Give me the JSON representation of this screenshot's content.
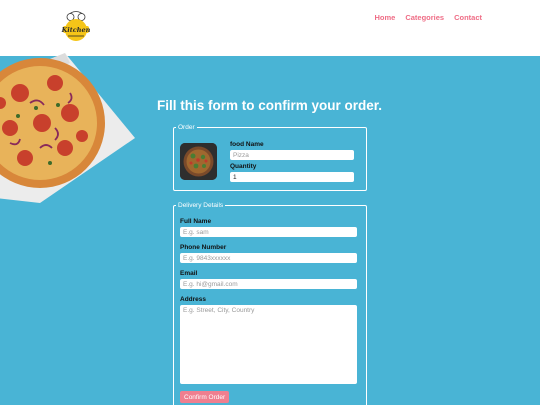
{
  "nav": {
    "home": "Home",
    "categories": "Categories",
    "contact": "Contact"
  },
  "logo": {
    "text": "Kitchen"
  },
  "form": {
    "title": "Fill this form to confirm your order.",
    "order": {
      "legend": "Order",
      "food_name_label": "food Name",
      "food_name_placeholder": "Pizza",
      "quantity_label": "Quantity",
      "quantity_value": "1"
    },
    "delivery": {
      "legend": "Delivery Details",
      "full_name_label": "Full Name",
      "full_name_placeholder": "E.g. sam",
      "phone_label": "Phone Number",
      "phone_placeholder": "E.g. 9843xxxxxx",
      "email_label": "Email",
      "email_placeholder": "E.g. hi@gmail.com",
      "address_label": "Address",
      "address_placeholder": "E.g. Street, City, Country",
      "submit_label": "Confirm Order"
    }
  },
  "colors": {
    "background": "#49b4d5",
    "accent": "#ef6d86",
    "button": "#ef7f8f"
  }
}
